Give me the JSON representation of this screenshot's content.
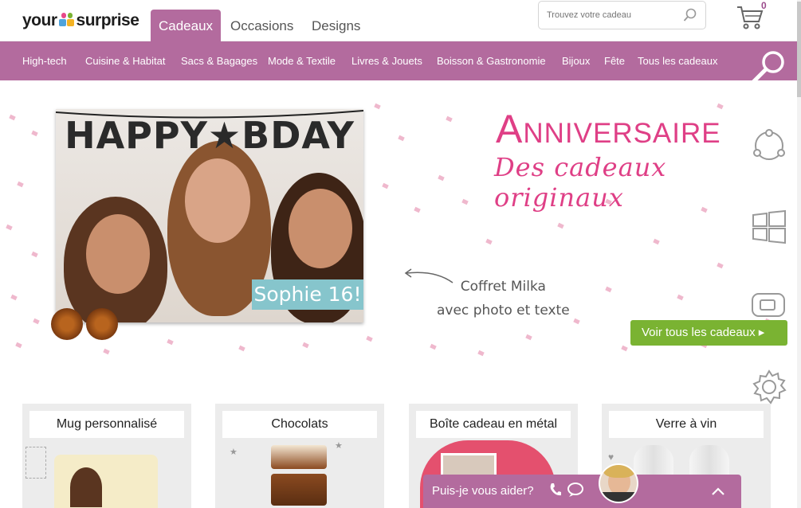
{
  "header": {
    "logo_left": "your",
    "logo_right": "surprise",
    "tabs": [
      {
        "label": "Cadeaux",
        "active": true
      },
      {
        "label": "Occasions",
        "active": false
      },
      {
        "label": "Designs",
        "active": false
      }
    ],
    "search_placeholder": "Trouvez votre cadeau",
    "search_icon": "search-icon",
    "cart_icon": "cart-icon",
    "cart_count": "0"
  },
  "categories": [
    "High-tech",
    "Cuisine & Habitat",
    "Sacs & Bagages",
    "Mode & Textile",
    "Livres & Jouets",
    "Boisson & Gastronomie",
    "Bijoux",
    "Fête",
    "Tous les cadeaux"
  ],
  "hero": {
    "banner_text": "HAPPY★BDAY",
    "photo_tag": "Sophie 16!",
    "title": "Anniversaire",
    "subtitle": "Des cadeaux originaux",
    "caption_line1": "Coffret Milka",
    "caption_line2": "avec photo et texte",
    "cta_label": "Voir tous les cadeaux ▸"
  },
  "side_icons": [
    "globe-network-icon",
    "windows-icon",
    "device-icon",
    "settings-gear-icon"
  ],
  "products": [
    {
      "label": "Mug personnalisé"
    },
    {
      "label": "Chocolats"
    },
    {
      "label": "Boîte cadeau en métal"
    },
    {
      "label": "Verre à vin"
    }
  ],
  "chat": {
    "label": "Puis-je vous aider?"
  },
  "colors": {
    "brand_purple": "#b36b9e",
    "title_pink": "#df3f86",
    "cta_green": "#7ab332",
    "tag_teal": "#86c5cc"
  }
}
